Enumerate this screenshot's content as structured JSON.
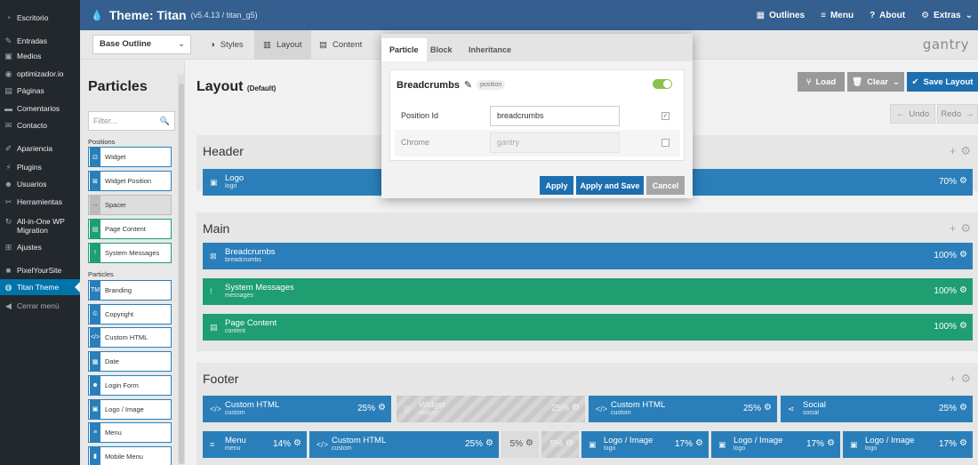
{
  "wp_menu": [
    {
      "label": "Escritorio",
      "icon": "dashboard-icon",
      "glyph": "◔"
    },
    {
      "label": "Entradas",
      "icon": "pin-icon",
      "glyph": "✎"
    },
    {
      "label": "Medios",
      "icon": "media-icon",
      "glyph": "▣"
    },
    {
      "label": "optimizador.io",
      "icon": "optimizer-icon",
      "glyph": "◉"
    },
    {
      "label": "Páginas",
      "icon": "pages-icon",
      "glyph": "▤"
    },
    {
      "label": "Comentarios",
      "icon": "comments-icon",
      "glyph": "▬"
    },
    {
      "label": "Contacto",
      "icon": "mail-icon",
      "glyph": "✉"
    },
    {
      "label": "Apariencia",
      "icon": "brush-icon",
      "glyph": "✐"
    },
    {
      "label": "Plugins",
      "icon": "plugin-icon",
      "glyph": "⚡"
    },
    {
      "label": "Usuarios",
      "icon": "users-icon",
      "glyph": "☻"
    },
    {
      "label": "Herramientas",
      "icon": "wrench-icon",
      "glyph": "✂"
    },
    {
      "label": "All-in-One WP Migration",
      "icon": "migration-icon",
      "glyph": "↻"
    },
    {
      "label": "Ajustes",
      "icon": "settings-icon",
      "glyph": "⊞"
    },
    {
      "label": "PixelYourSite",
      "icon": "pixel-icon",
      "glyph": "■"
    },
    {
      "label": "Titan Theme",
      "icon": "gantry-icon",
      "glyph": "◍"
    },
    {
      "label": "Cerrar menú",
      "icon": "collapse-icon",
      "glyph": "◀"
    }
  ],
  "header": {
    "title": "Theme: Titan",
    "version": "(v5.4.13 / titan_g5)",
    "menu": [
      {
        "label": "Outlines",
        "icon": "grid-icon",
        "glyph": "▦"
      },
      {
        "label": "Menu",
        "icon": "hamburger-icon",
        "glyph": "≡"
      },
      {
        "label": "About",
        "icon": "question-icon",
        "glyph": "?"
      },
      {
        "label": "Extras",
        "icon": "gear-icon",
        "glyph": "⚙"
      }
    ]
  },
  "toolbar": {
    "outline": "Base Outline",
    "tabs": [
      {
        "label": "Styles",
        "icon": "palette-icon",
        "glyph": "◑"
      },
      {
        "label": "Layout",
        "icon": "layout-icon",
        "glyph": "▥"
      },
      {
        "label": "Content",
        "icon": "content-icon",
        "glyph": "▤"
      }
    ],
    "brand": "gantry"
  },
  "particles_panel": {
    "title": "Particles",
    "filter_placeholder": "Filter...",
    "positions_heading": "Positions",
    "particles_heading": "Particles",
    "positions": [
      {
        "label": "Widget",
        "glyph": "⊡",
        "icon": "widget-icon",
        "color": "blue"
      },
      {
        "label": "Widget Position",
        "glyph": "⊠",
        "icon": "widget-position-icon",
        "color": "blue"
      },
      {
        "label": "Spacer",
        "glyph": "↔",
        "icon": "spacer-icon",
        "color": "gray"
      },
      {
        "label": "Page Content",
        "glyph": "▤",
        "icon": "page-content-icon",
        "color": "green"
      },
      {
        "label": "System Messages",
        "glyph": "!",
        "icon": "system-messages-icon",
        "color": "green"
      }
    ],
    "particles": [
      {
        "label": "Branding",
        "glyph": "TM",
        "icon": "branding-icon",
        "color": "blue"
      },
      {
        "label": "Copyright",
        "glyph": "©",
        "icon": "copyright-icon",
        "color": "blue"
      },
      {
        "label": "Custom HTML",
        "glyph": "</>",
        "icon": "code-icon",
        "color": "blue"
      },
      {
        "label": "Date",
        "glyph": "▦",
        "icon": "calendar-icon",
        "color": "blue"
      },
      {
        "label": "Login Form",
        "glyph": "☻",
        "icon": "user-icon",
        "color": "blue"
      },
      {
        "label": "Logo / Image",
        "glyph": "▣",
        "icon": "image-icon",
        "color": "blue"
      },
      {
        "label": "Menu",
        "glyph": "≡",
        "icon": "menu-icon",
        "color": "blue"
      },
      {
        "label": "Mobile Menu",
        "glyph": "▮",
        "icon": "mobile-icon",
        "color": "blue"
      }
    ]
  },
  "layout": {
    "title": "Layout",
    "subtitle": "(Default)",
    "buttons": {
      "load": "Load",
      "clear": "Clear",
      "save": "Save Layout",
      "undo": "Undo",
      "redo": "Redo"
    },
    "sections": [
      {
        "title": "Header"
      },
      {
        "title": "Main"
      },
      {
        "title": "Footer"
      }
    ],
    "header_blocks": [
      {
        "name": "Logo",
        "sub": "logo",
        "pct": "70%",
        "type": "blue",
        "glyph": "▣",
        "icon": "image-icon"
      }
    ],
    "main_blocks": [
      {
        "name": "Breadcrumbs",
        "sub": "breadcrumbs",
        "pct": "100%",
        "type": "blue",
        "glyph": "⊠",
        "icon": "breadcrumbs-icon"
      },
      {
        "name": "System Messages",
        "sub": "messages",
        "pct": "100%",
        "type": "green",
        "glyph": "!",
        "icon": "system-messages-icon"
      },
      {
        "name": "Page Content",
        "sub": "content",
        "pct": "100%",
        "type": "green",
        "glyph": "▤",
        "icon": "page-content-icon"
      }
    ],
    "footer_row1": [
      {
        "name": "Custom HTML",
        "sub": "custom",
        "pct": "25%",
        "type": "blue",
        "glyph": "</>",
        "icon": "code-icon"
      },
      {
        "name": "Widget",
        "sub": "widget",
        "pct": "25%",
        "type": "disabled",
        "glyph": "⊡",
        "icon": "widget-icon"
      },
      {
        "name": "Custom HTML",
        "sub": "custom",
        "pct": "25%",
        "type": "blue",
        "glyph": "</>",
        "icon": "code-icon"
      },
      {
        "name": "Social",
        "sub": "social",
        "pct": "25%",
        "type": "blue",
        "glyph": "⋖",
        "icon": "share-icon"
      }
    ],
    "footer_row2": [
      {
        "name": "Menu",
        "sub": "menu",
        "pct": "14%",
        "type": "blue",
        "glyph": "≡",
        "icon": "menu-icon"
      },
      {
        "name": "Custom HTML",
        "sub": "custom",
        "pct": "25%",
        "type": "blue",
        "glyph": "</>",
        "icon": "code-icon"
      },
      {
        "name": "",
        "sub": "",
        "pct": "5%",
        "type": "spacer",
        "glyph": "",
        "icon": "spacer-icon"
      },
      {
        "name": "",
        "sub": "",
        "pct": "5%",
        "type": "disabled",
        "glyph": "",
        "icon": "spacer-icon"
      },
      {
        "name": "Logo / Image",
        "sub": "logo",
        "pct": "17%",
        "type": "blue",
        "glyph": "▣",
        "icon": "image-icon"
      },
      {
        "name": "Logo / Image",
        "sub": "logo",
        "pct": "17%",
        "type": "blue",
        "glyph": "▣",
        "icon": "image-icon"
      },
      {
        "name": "Logo / Image",
        "sub": "logo",
        "pct": "17%",
        "type": "blue",
        "glyph": "▣",
        "icon": "image-icon"
      }
    ]
  },
  "modal": {
    "tabs": [
      "Particle",
      "Block",
      "Inheritance"
    ],
    "title": "Breadcrumbs",
    "badge": "position",
    "enabled": true,
    "fields": [
      {
        "label": "Position Id",
        "value": "breadcrumbs",
        "checked": true
      },
      {
        "label": "Chrome",
        "value": "gantry",
        "checked": false
      }
    ],
    "buttons": {
      "apply": "Apply",
      "apply_save": "Apply and Save",
      "cancel": "Cancel"
    }
  },
  "colors": {
    "header": "#345f8f",
    "wp_sidebar": "#23282d",
    "particle_blue": "#2a7fba",
    "particle_green": "#1f9e72",
    "save_button": "#1d6fb0"
  }
}
